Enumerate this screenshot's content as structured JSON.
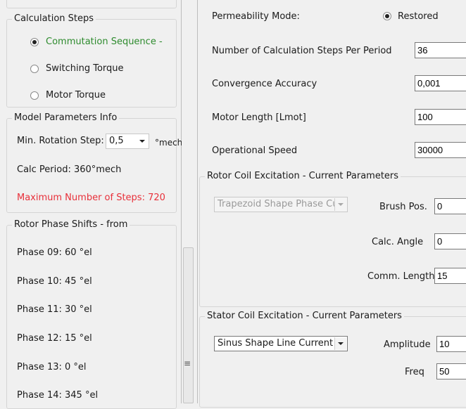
{
  "left": {
    "calc_steps": {
      "title": "Calculation Steps",
      "options": [
        "Commutation Sequence -",
        "Switching Torque",
        "Motor Torque"
      ],
      "selected_color": "#2e8b2e"
    },
    "model_info": {
      "title": "Model Parameters Info",
      "min_rotation_label": "Min. Rotation Step:",
      "min_rotation_value": "0,5",
      "min_rotation_unit": "°mech",
      "calc_period": "Calc Period: 360°mech",
      "max_steps": "Maximum Number of Steps: 720",
      "max_steps_color": "#e8303a"
    },
    "phase_shifts": {
      "title": "Rotor Phase Shifts - from",
      "items": [
        "Phase 09: 60 °el",
        "Phase 10: 45 °el",
        "Phase 11: 30 °el",
        "Phase 12: 15 °el",
        "Phase 13: 0 °el",
        "Phase 14: 345 °el"
      ]
    }
  },
  "splitter": {
    "grip": "≡"
  },
  "right": {
    "permeability_label": "Permeability Mode:",
    "permeability_option": "Restored",
    "steps_label": "Number of Calculation Steps Per Period",
    "steps_value": "36",
    "accuracy_label": "Convergence Accuracy",
    "accuracy_value": "0,001",
    "length_label": "Motor Length [Lmot]",
    "length_value": "100",
    "speed_label": "Operational Speed",
    "speed_value": "30000",
    "rotor": {
      "title": "Rotor Coil Excitation - Current Parameters",
      "shape_value": "Trapezoid Shape Phase Cu",
      "brush_label": "Brush Pos.",
      "brush_value": "0",
      "angle_label": "Calc. Angle",
      "angle_value": "0",
      "comm_label": "Comm. Length",
      "comm_value": "15"
    },
    "stator": {
      "title": "Stator Coil Excitation - Current Parameters",
      "shape_value": "Sinus Shape Line Current",
      "amplitude_label": "Amplitude",
      "amplitude_value": "10",
      "freq_label": "Freq",
      "freq_value": "50"
    }
  }
}
